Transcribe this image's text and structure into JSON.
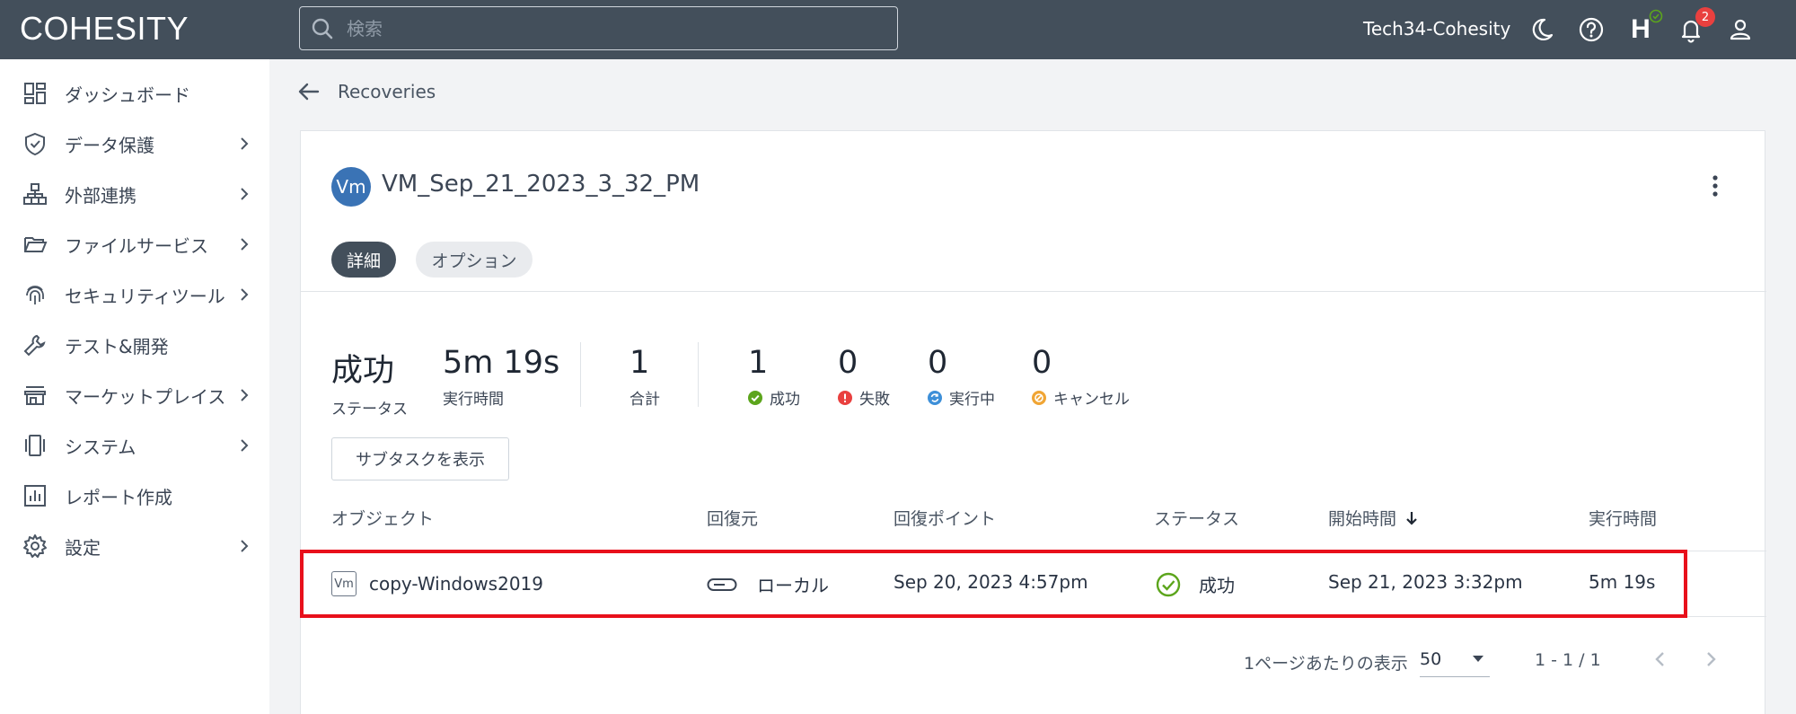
{
  "topbar": {
    "logo_text": "COHESITY",
    "search_placeholder": "検索",
    "tenant_name": "Tech34-Cohesity",
    "h_label": "H",
    "notification_count": "2",
    "icons": [
      "moon-icon",
      "help-icon",
      "helios-icon",
      "bell-icon",
      "user-icon"
    ]
  },
  "sidebar": {
    "items": [
      {
        "label": "ダッシュボード",
        "icon": "dashboard-icon",
        "has_children": false
      },
      {
        "label": "データ保護",
        "icon": "shield-icon",
        "has_children": true
      },
      {
        "label": "外部連携",
        "icon": "hierarchy-icon",
        "has_children": true
      },
      {
        "label": "ファイルサービス",
        "icon": "folder-icon",
        "has_children": true
      },
      {
        "label": "セキュリティツール",
        "icon": "fingerprint-icon",
        "has_children": true
      },
      {
        "label": "テスト&開発",
        "icon": "wrench-icon",
        "has_children": false
      },
      {
        "label": "マーケットプレイス",
        "icon": "store-icon",
        "has_children": true
      },
      {
        "label": "システム",
        "icon": "device-icon",
        "has_children": true
      },
      {
        "label": "レポート作成",
        "icon": "report-icon",
        "has_children": false
      },
      {
        "label": "設定",
        "icon": "gear-icon",
        "has_children": true
      }
    ]
  },
  "breadcrumb": {
    "label": "Recoveries"
  },
  "recovery": {
    "avatar": "Vm",
    "title": "VM_Sep_21_2023_3_32_PM",
    "tabs": [
      {
        "label": "詳細",
        "active": true
      },
      {
        "label": "オプション",
        "active": false
      }
    ]
  },
  "stats": {
    "status_value": "成功",
    "status_label": "ステータス",
    "duration_value": "5m 19s",
    "duration_label": "実行時間",
    "total_value": "1",
    "total_label": "合計",
    "success_value": "1",
    "success_label": "成功",
    "failed_value": "0",
    "failed_label": "失敗",
    "running_value": "0",
    "running_label": "実行中",
    "canceled_value": "0",
    "canceled_label": "キャンセル"
  },
  "subtask_button": "サブタスクを表示",
  "table": {
    "headers": {
      "object": "オブジェクト",
      "source": "回復元",
      "recovery_point": "回復ポイント",
      "status": "ステータス",
      "start_time": "開始時間",
      "duration": "実行時間"
    },
    "rows": [
      {
        "object_icon_text": "Vm",
        "object": "copy-Windows2019",
        "source": "ローカル",
        "recovery_point": "Sep 20, 2023 4:57pm",
        "status": "成功",
        "start_time": "Sep 21, 2023 3:32pm",
        "duration": "5m 19s"
      }
    ]
  },
  "pagination": {
    "per_page_label": "1ページあたりの表示",
    "per_page_value": "50",
    "range": "1 - 1 / 1"
  },
  "colors": {
    "topbar": "#434f5b",
    "accent_green": "#5ca51c",
    "error_red": "#e9403f",
    "running_blue": "#3d8fd8",
    "cancel_orange": "#f0a534",
    "highlight": "#e8101b"
  }
}
